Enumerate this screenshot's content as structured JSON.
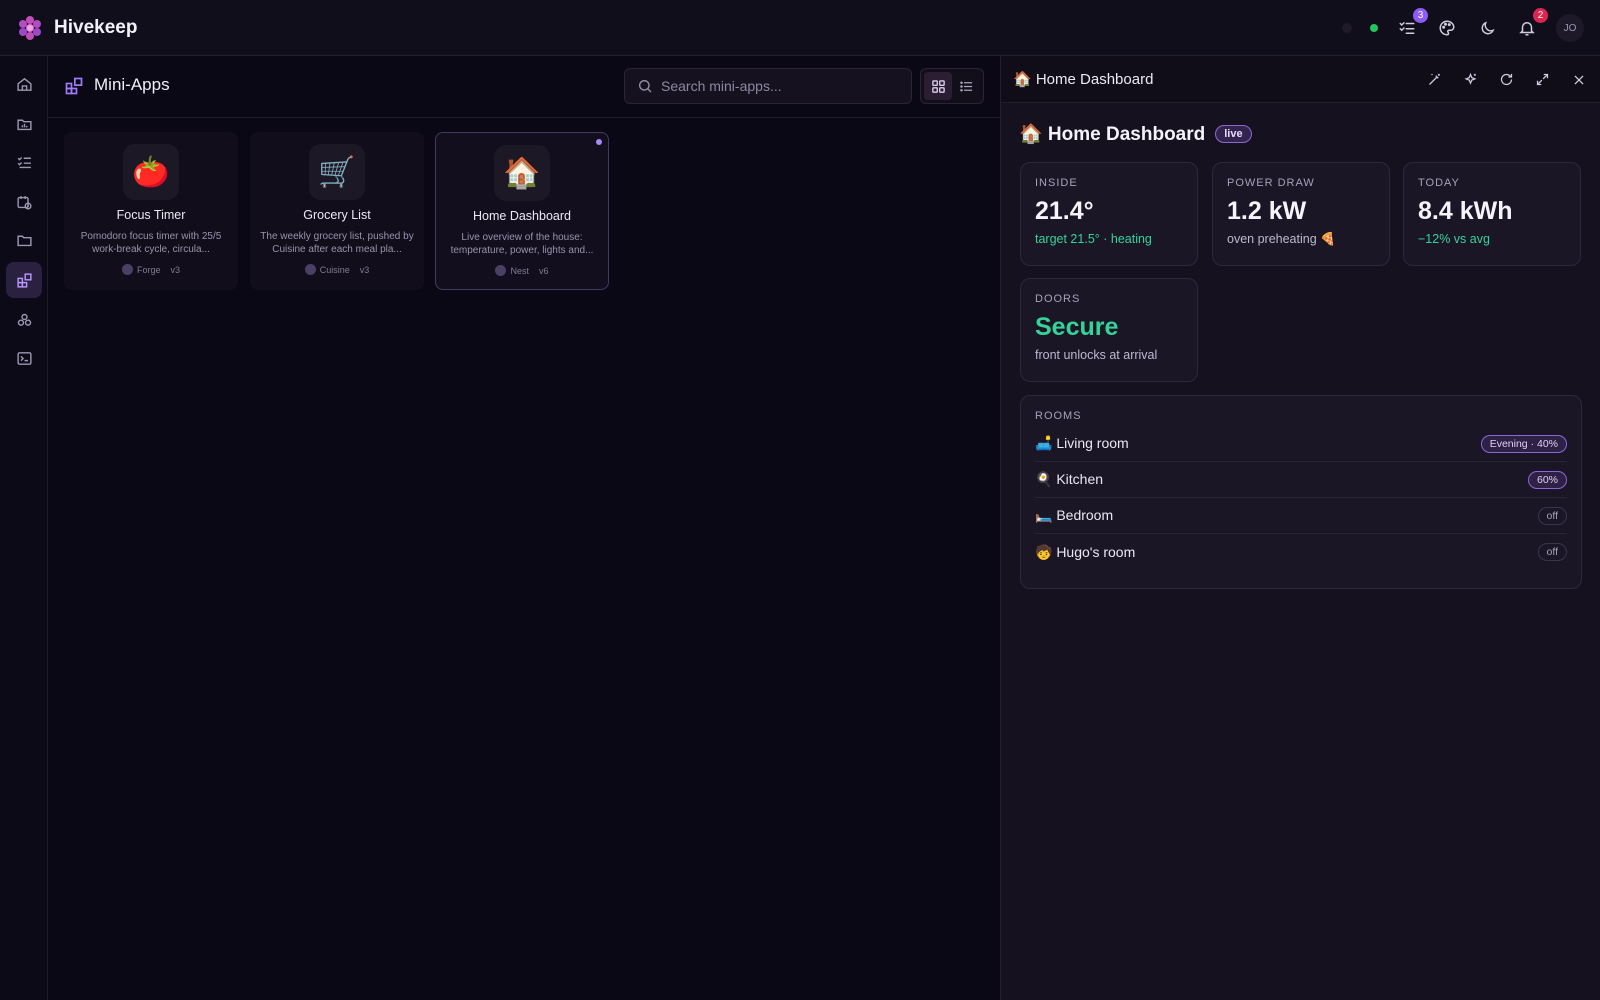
{
  "app": {
    "name": "Hivekeep"
  },
  "topbar": {
    "tasks_badge": "3",
    "notifications_badge": "2",
    "avatar_initials": "JO"
  },
  "main": {
    "title": "Mini-Apps",
    "search": {
      "placeholder": "Search mini-apps..."
    },
    "cards": [
      {
        "emoji": "🍅",
        "title": "Focus Timer",
        "description": "Pomodoro focus timer with 25/5 work-break cycle, circula...",
        "author": "Forge",
        "version": "v3"
      },
      {
        "emoji": "🛒",
        "title": "Grocery List",
        "description": "The weekly grocery list, pushed by Cuisine after each meal pla...",
        "author": "Cuisine",
        "version": "v3"
      },
      {
        "emoji": "🏠",
        "title": "Home Dashboard",
        "description": "Live overview of the house: temperature, power, lights and...",
        "author": "Nest",
        "version": "v6"
      }
    ]
  },
  "panel": {
    "header_title": "🏠 Home Dashboard",
    "dashboard_title": "🏠 Home Dashboard",
    "live_label": "live",
    "stats": [
      {
        "label": "INSIDE",
        "value": "21.4°",
        "sub": "target 21.5° · heating"
      },
      {
        "label": "POWER DRAW",
        "value": "1.2 kW",
        "sub": "oven preheating 🍕"
      },
      {
        "label": "TODAY",
        "value": "8.4 kWh",
        "sub": "−12% vs avg"
      },
      {
        "label": "DOORS",
        "value": "Secure",
        "sub": "front unlocks at arrival"
      }
    ],
    "rooms_label": "ROOMS",
    "rooms": [
      {
        "name": "🛋️ Living room",
        "status": "Evening · 40%"
      },
      {
        "name": "🍳 Kitchen",
        "status": "60%"
      },
      {
        "name": "🛏️ Bedroom",
        "status": "off"
      },
      {
        "name": "🧒 Hugo's room",
        "status": "off"
      }
    ]
  },
  "colors": {
    "accent": "#8b5cf6",
    "positive": "#34d399",
    "alert": "#dc2650"
  }
}
